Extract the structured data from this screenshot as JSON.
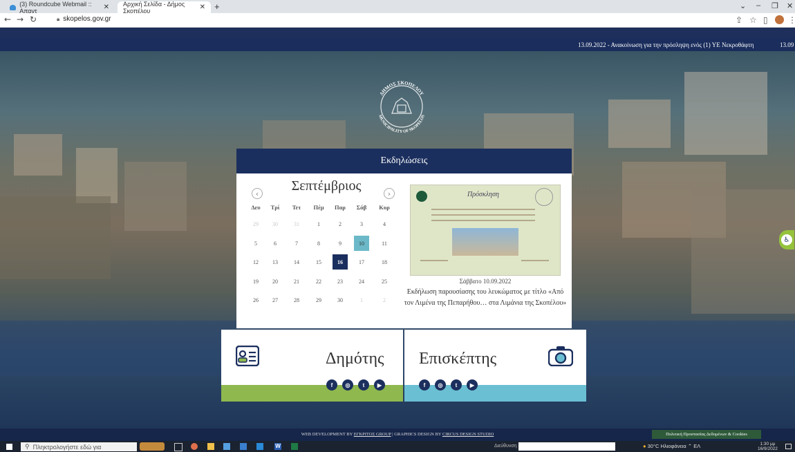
{
  "browser": {
    "tabs": [
      {
        "label": "(3) Roundcube Webmail :: Απαντ"
      },
      {
        "label": "Αρχική Σελίδα - Δήμος Σκοπέλου"
      }
    ],
    "url": "skopelos.gov.gr"
  },
  "ticker": {
    "text": "13.09.2022 - Ανακοίνωση για την πρόσληψη ενός (1) ΥΕ Νεκροθάφτη",
    "repeat_start": "13.09"
  },
  "logo": {
    "top_text": "ΔΗΜΟΣ ΣΚΟΠΕΛΟΥ",
    "bottom_text": "MUNICIPALITY OF SKOPELOS"
  },
  "events": {
    "header": "Εκδηλώσεις",
    "month": "Σεπτέμβριος",
    "weekdays": [
      "Δευ",
      "Τρί",
      "Τετ",
      "Πέμ",
      "Παρ",
      "Σάβ",
      "Κυρ"
    ],
    "weeks": [
      [
        "29",
        "30",
        "31",
        "1",
        "2",
        "3",
        "4"
      ],
      [
        "5",
        "6",
        "7",
        "8",
        "9",
        "10",
        "11"
      ],
      [
        "12",
        "13",
        "14",
        "15",
        "16",
        "17",
        "18"
      ],
      [
        "19",
        "20",
        "21",
        "22",
        "23",
        "24",
        "25"
      ],
      [
        "26",
        "27",
        "28",
        "29",
        "30",
        "1",
        "2"
      ]
    ],
    "selected_day": "10",
    "current_day": "16",
    "event_card": {
      "poster_title": "Πρόσκληση",
      "date": "Σάββατο 10.09.2022",
      "title": "Εκδήλωση παρουσίασης του λευκώματος με τίτλο «Από τον Λιμένα της Πεπαρήθου… στα Λιμάνια της Σκοπέλου»"
    }
  },
  "sections": {
    "citizen": "Δημότης",
    "visitor": "Επισκέπτης"
  },
  "social": [
    "facebook",
    "instagram",
    "twitter",
    "youtube"
  ],
  "footer": {
    "credits_prefix": "WEB DEVELOPMENT BY ",
    "credits_dev": "ΕΓΚΡΙΤΟΣ GROUP",
    "credits_mid": " | GRAPHICS DESIGN BY ",
    "credits_design": "CIRCUS DESIGN STUDIO",
    "cookies": "Πολιτική Προστασίας Δεδομένων & Cookies"
  },
  "taskbar": {
    "search_placeholder": "Πληκτρολογήστε εδώ για",
    "address_label": "Διεύθυνση",
    "weather": "30°C Ηλιοφάνεια",
    "lang": "ΕΛ",
    "time": "1:30 μμ",
    "date": "16/9/2022"
  },
  "colors": {
    "navy": "#1b2f5e",
    "green": "#8fb84e",
    "cyan": "#6bbfd3",
    "selected": "#6bb9c8"
  }
}
